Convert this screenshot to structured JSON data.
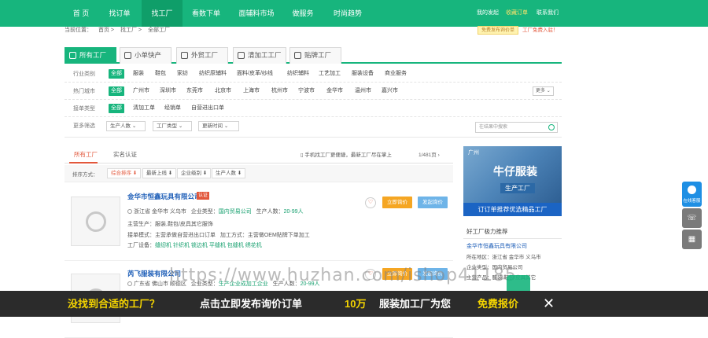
{
  "nav": {
    "items": [
      "首 页",
      "找订单",
      "找工厂",
      "看数下单",
      "面辅料市场",
      "做服务",
      "时尚趋势"
    ],
    "right": [
      "我的发起",
      "收藏订单",
      "联系我们"
    ]
  },
  "breadcrumb": [
    "当前位置：",
    "首页",
    "找工厂",
    "全部工厂"
  ],
  "publish_badge": "免费发布询价单",
  "enter_link": "工厂免费入驻！",
  "tabs": [
    "所有工厂",
    "小单快产",
    "外贸工厂",
    "清加工工厂",
    "贴牌工厂"
  ],
  "filters": {
    "industry": {
      "label": "行业类别",
      "options": [
        "全部",
        "服装",
        "鞋包",
        "家纺",
        "纺织原辅料",
        "面料/皮革/纱线",
        "纺织辅料",
        "工艺加工",
        "服装设备",
        "商业服务"
      ]
    },
    "city": {
      "label": "热门城市",
      "options": [
        "全部",
        "广州市",
        "深圳市",
        "东莞市",
        "北京市",
        "上海市",
        "杭州市",
        "宁波市",
        "金华市",
        "温州市",
        "嘉兴市"
      ],
      "more": "更多"
    },
    "order_type": {
      "label": "接单类型",
      "options": [
        "全部",
        "清加工单",
        "经销单",
        "自营进出口单"
      ]
    },
    "more_filters": {
      "label": "更多筛选",
      "selects": [
        "生产人数",
        "工厂类型",
        "更新时间"
      ]
    }
  },
  "search": {
    "placeholder": "在结果中搜索"
  },
  "list_tabs": [
    "所有工厂",
    "实名认证"
  ],
  "phone_tip": "手机找工厂更便捷，最新工厂尽在掌上",
  "pager": "1/481页",
  "sort": {
    "label": "排序方式：",
    "options": [
      "综合排序 ⬇",
      "最新上线 ⬇",
      "企业级别 ⬇",
      "生产人数 ⬇"
    ]
  },
  "cards": [
    {
      "name": "金华市恒鑫玩具有限公司",
      "tag": "认证",
      "line1": [
        "浙江省 金华市 义乌市",
        "企业类型：",
        "国内贸易公司",
        "生产人数：",
        "20-99人"
      ],
      "line2": "主营生产：服装,鞋包/皮具其它服饰",
      "line3": [
        "接单模式：主营承做自营进出口订单",
        "加工方式：主营做OEM贴牌下单加工"
      ],
      "line4": [
        "工厂设备：",
        "缝纫机 针织机 锁边机 平缝机 包缝机 绣花机"
      ],
      "btn_inquiry": "立即询价",
      "btn_contact": "发起询价"
    },
    {
      "name": "芮飞服装有限公司",
      "tag": "",
      "line1": [
        "广东省 佛山市 顺德区",
        "企业类型：",
        "生产企业成加工企业",
        "生产人数：",
        "20-99人"
      ],
      "line2": "",
      "line3": [
        "",
        ""
      ],
      "line4": [
        "",
        ""
      ],
      "btn_inquiry": "立即询价",
      "btn_contact": "发起询价"
    }
  ],
  "ad": {
    "corner": "广州",
    "title": "牛仔服装",
    "sub": "生产工厂",
    "bar": "订订单推荐优选精品工厂"
  },
  "side": {
    "heading": "好工厂极力推荐",
    "company": "金华市恒鑫玩具有限公司",
    "lines": [
      "所在地区：浙江省 金华市 义乌市",
      "企业类型：国内贸易公司",
      "主营产品：服装,鞋包/皮具其它"
    ]
  },
  "float": {
    "service": "在线客服",
    "phone_icon": "☏",
    "qr_icon": "▦"
  },
  "watermark": "https://www.huzhan.com/ishop41185",
  "bottom": {
    "a": "没找到合适的工厂？",
    "b": "点击立即发布询价订单",
    "c": "10万",
    "d": "服装加工厂为您",
    "e": "免费报价",
    "close": "✕"
  },
  "colors": {
    "brand": "#17b57d",
    "accent": "#e2573b",
    "link": "#1f5fb8"
  }
}
